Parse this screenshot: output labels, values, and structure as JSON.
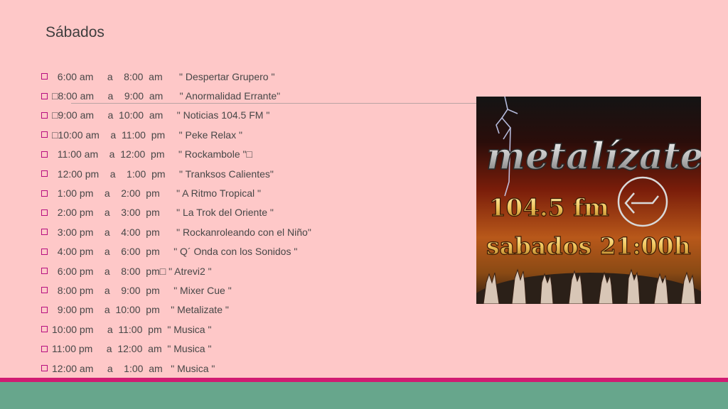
{
  "slide": {
    "title": "Sábados"
  },
  "schedule": [
    "  6:00 am     a    8:00  am      \" Despertar Grupero \"",
    "□8:00 am     a    9:00  am      \" Anormalidad Errante\"",
    "□9:00 am     a  10:00  am     \" Noticias 104.5 FM \"",
    "□10:00 am    a  11:00  pm     \" Peke Relax \"",
    "  11:00 am    a  12:00  pm     \" Rockambole \"□",
    "  12:00 pm    a    1:00  pm     \" Tranksos Calientes\"",
    "  1:00 pm    a    2:00  pm      \" A Ritmo Tropical \"",
    "  2:00 pm    a    3:00  pm      \" La Trok del Oriente \"",
    "  3:00 pm    a    4:00  pm      \" Rockanroleando con el Niño\"",
    "  4:00 pm    a    6:00  pm     \" Q´ Onda con los Sonidos \"",
    "  6:00 pm    a    8:00  pm□ \" Atrevi2 \"",
    "  8:00 pm    a    9:00  pm     \" Mixer Cue \"",
    "  9:00 pm    a  10:00  pm    \" Metalizate \"",
    "10:00 pm     a  11:00  pm  \" Musica \"",
    "11:00 pm     a  12:00  am  \" Musica \"",
    "12:00 am     a    1:00  am   \" Musica \""
  ],
  "poster": {
    "logo_text": "metalízate",
    "frequency": "104.5 fm",
    "schedule_text": "sabados 21:00h",
    "colors": {
      "bg_top": "#1a1a1a",
      "bg_mid": "#7a1d0a",
      "bg_low": "#c8741a",
      "gold": "#f0c35a",
      "silver": "#dcdcdc"
    }
  },
  "theme": {
    "background": "#fec8c8",
    "bullet": "#b70f80",
    "stripe": "#d11c72",
    "footer": "#67a68c"
  }
}
